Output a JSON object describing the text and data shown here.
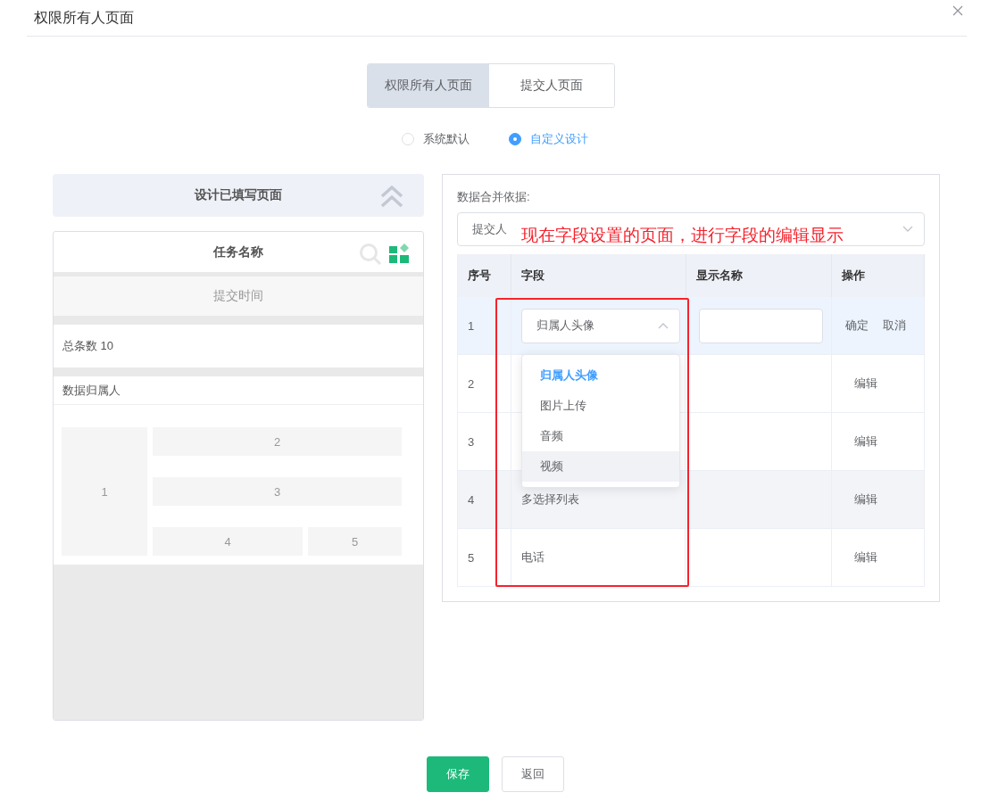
{
  "dialog": {
    "title": "权限所有人页面"
  },
  "page_tabs": [
    {
      "label": "权限所有人页面",
      "selected": true
    },
    {
      "label": "提交人页面",
      "selected": false
    }
  ],
  "design_mode": [
    {
      "label": "系统默认",
      "selected": false
    },
    {
      "label": "自定义设计",
      "selected": true
    }
  ],
  "preview": {
    "header": "设计已填写页面",
    "title": "任务名称",
    "time_label": "提交时间",
    "total": "总条数 10",
    "owner_label": "数据归属人",
    "blocks": [
      "1",
      "2",
      "3",
      "4",
      "5"
    ]
  },
  "merge": {
    "label": "数据合并依据:",
    "value": "提交人"
  },
  "annotation": {
    "text": "现在字段设置的页面，进行字段的编辑显示"
  },
  "table": {
    "columns": [
      "序号",
      "字段",
      "显示名称",
      "操作"
    ],
    "rows": [
      {
        "kind": "editing",
        "index": "1",
        "field": "归属人头像",
        "actions": [
          "确定",
          "取消"
        ]
      },
      {
        "kind": "view",
        "index": "2",
        "actions": [
          "编辑"
        ],
        "highlighted": false
      },
      {
        "kind": "view",
        "index": "3",
        "actions": [
          "编辑"
        ],
        "highlighted": false
      },
      {
        "kind": "view",
        "index": "4",
        "field": "多选择列表",
        "actions": [
          "编辑"
        ],
        "highlighted": true
      },
      {
        "kind": "view",
        "index": "5",
        "field": "电话",
        "actions": [
          "编辑"
        ],
        "highlighted": false
      }
    ]
  },
  "dropdown": {
    "options": [
      {
        "label": "归属人头像",
        "selected": true,
        "hovered": false
      },
      {
        "label": "图片上传",
        "selected": false,
        "hovered": false
      },
      {
        "label": "音频",
        "selected": false,
        "hovered": false
      },
      {
        "label": "视频",
        "selected": false,
        "hovered": true
      }
    ]
  },
  "buttons": [
    {
      "kind": "primary",
      "label": "保存"
    },
    {
      "kind": "default",
      "label": "返回"
    }
  ]
}
